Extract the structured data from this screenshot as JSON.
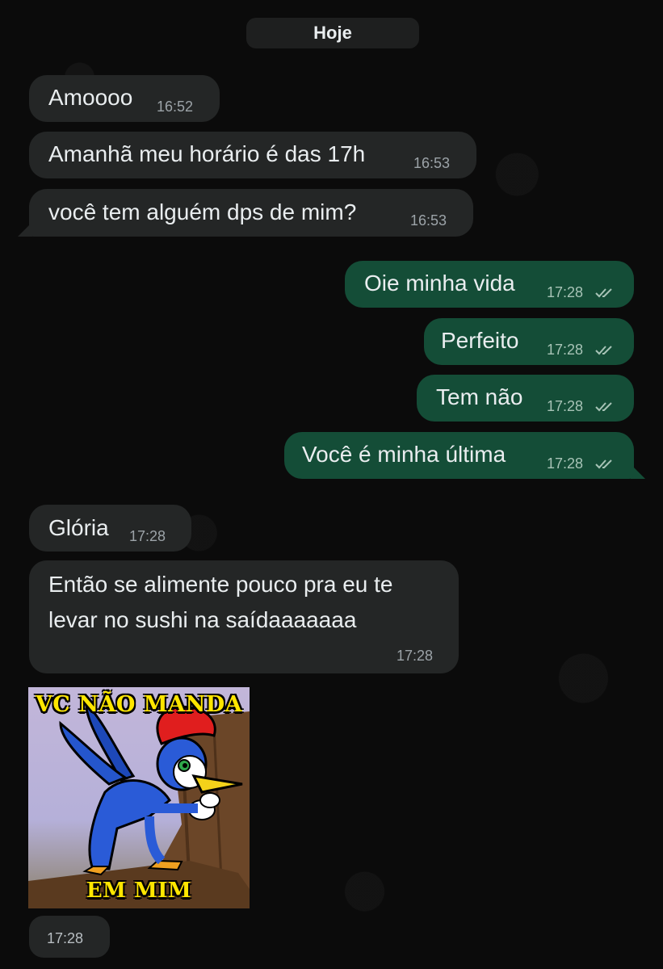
{
  "date_chip": "Hoje",
  "messages": [
    {
      "text": "Amoooo",
      "time": "16:52"
    },
    {
      "text": "Amanhã meu horário é das 17h",
      "time": "16:53"
    },
    {
      "text": "você tem alguém dps de mim?",
      "time": "16:53"
    },
    {
      "text": "Oie minha vida",
      "time": "17:28"
    },
    {
      "text": "Perfeito",
      "time": "17:28"
    },
    {
      "text": "Tem não",
      "time": "17:28"
    },
    {
      "text": "Você é minha última",
      "time": "17:28"
    },
    {
      "text": "Glória",
      "time": "17:28"
    },
    {
      "text_line1": "Então se alimente pouco pra eu te",
      "text_line2": "levar no sushi na saídaaaaaaa",
      "time": "17:28"
    }
  ],
  "sticker": {
    "top_caption": "VC NÃO MANDA",
    "bottom_caption": "EM MIM",
    "time": "17:28"
  },
  "colors": {
    "incoming_bubble": "#242626",
    "outgoing_bubble": "#144d37",
    "background": "#0b0b0b",
    "read_ticks": "#a7c3b6"
  }
}
